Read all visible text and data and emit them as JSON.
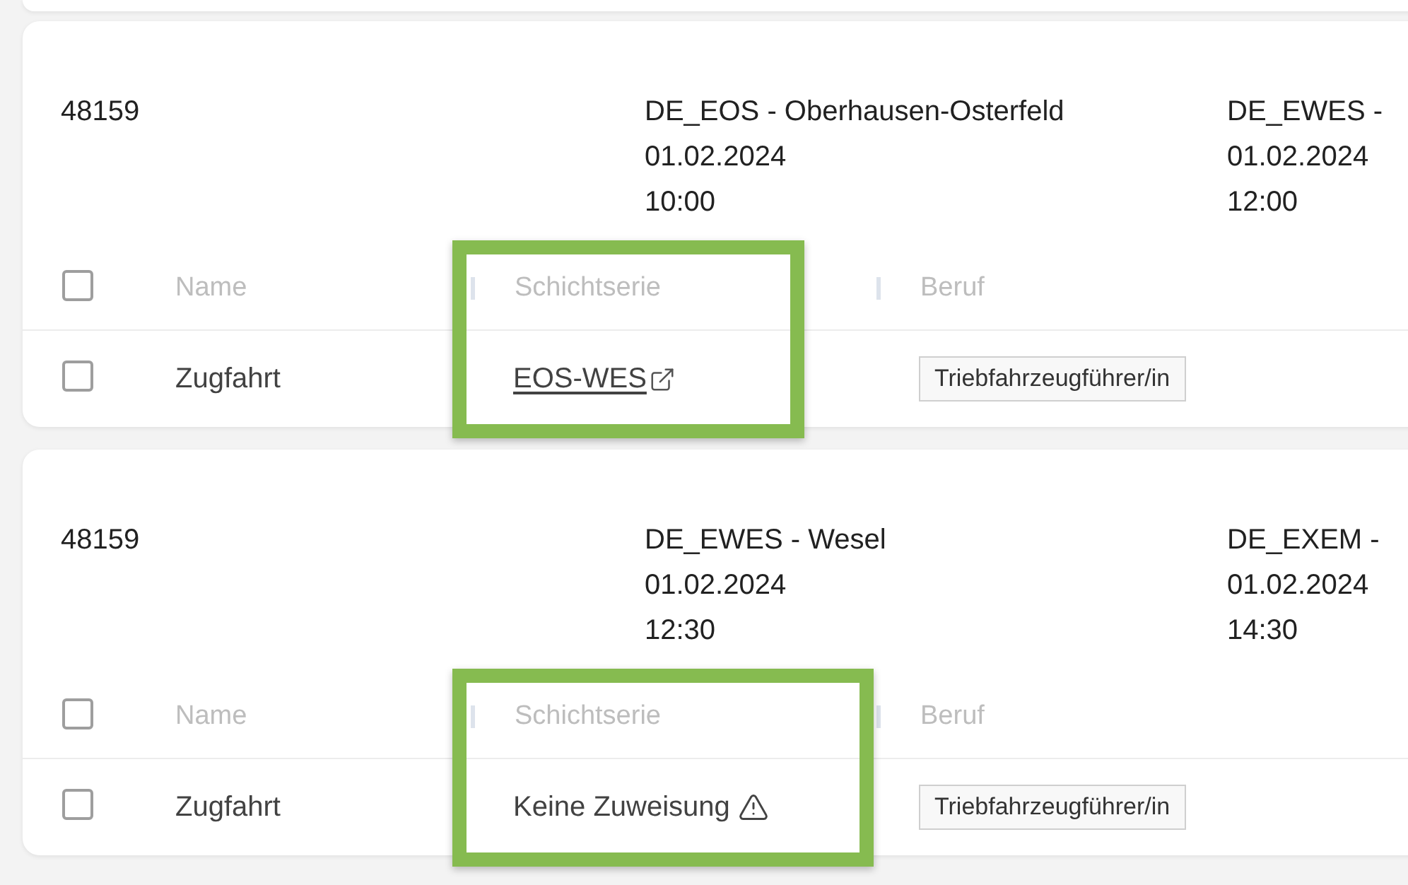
{
  "cards": [
    {
      "train_number": "48159",
      "stops": [
        {
          "station": "DE_EOS - Oberhausen-Osterfeld",
          "date": "01.02.2024",
          "time": "10:00"
        },
        {
          "station": "DE_EWES -",
          "date": "01.02.2024",
          "time": "12:00"
        }
      ],
      "table": {
        "select_all": {
          "checked": false
        },
        "columns": [
          "Name",
          "Schichtserie",
          "Beruf"
        ],
        "rows": [
          {
            "checked": false,
            "name": "Zugfahrt",
            "shift_series": {
              "kind": "link",
              "text": "EOS-WES",
              "highlighted": true
            },
            "job": "Triebfahrzeugführer/in"
          }
        ]
      }
    },
    {
      "train_number": "48159",
      "stops": [
        {
          "station": "DE_EWES - Wesel",
          "date": "01.02.2024",
          "time": "12:30"
        },
        {
          "station": "DE_EXEM -",
          "date": "01.02.2024",
          "time": "14:30"
        }
      ],
      "table": {
        "select_all": {
          "checked": false
        },
        "columns": [
          "Name",
          "Schichtserie",
          "Beruf"
        ],
        "rows": [
          {
            "checked": false,
            "name": "Zugfahrt",
            "shift_series": {
              "kind": "warning",
              "text": "Keine Zuweisung",
              "highlighted": true
            },
            "job": "Triebfahrzeugführer/in"
          }
        ]
      }
    }
  ]
}
